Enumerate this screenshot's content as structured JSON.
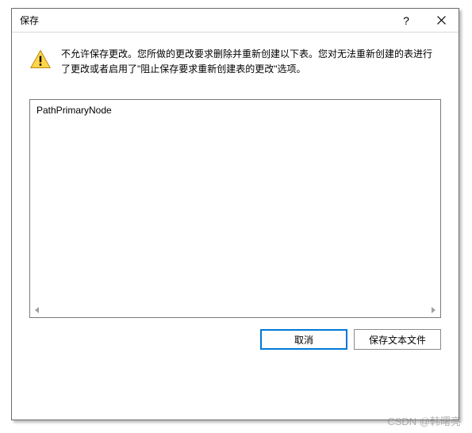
{
  "dialog": {
    "title": "保存",
    "help_glyph": "?",
    "message": "不允许保存更改。您所做的更改要求删除并重新创建以下表。您对无法重新创建的表进行了更改或者启用了\"阻止保存要求重新创建表的更改\"选项。"
  },
  "list": {
    "items": [
      "PathPrimaryNode"
    ]
  },
  "buttons": {
    "cancel": "取消",
    "save_text_file": "保存文本文件"
  },
  "watermark": "CSDN @韩曙亮"
}
